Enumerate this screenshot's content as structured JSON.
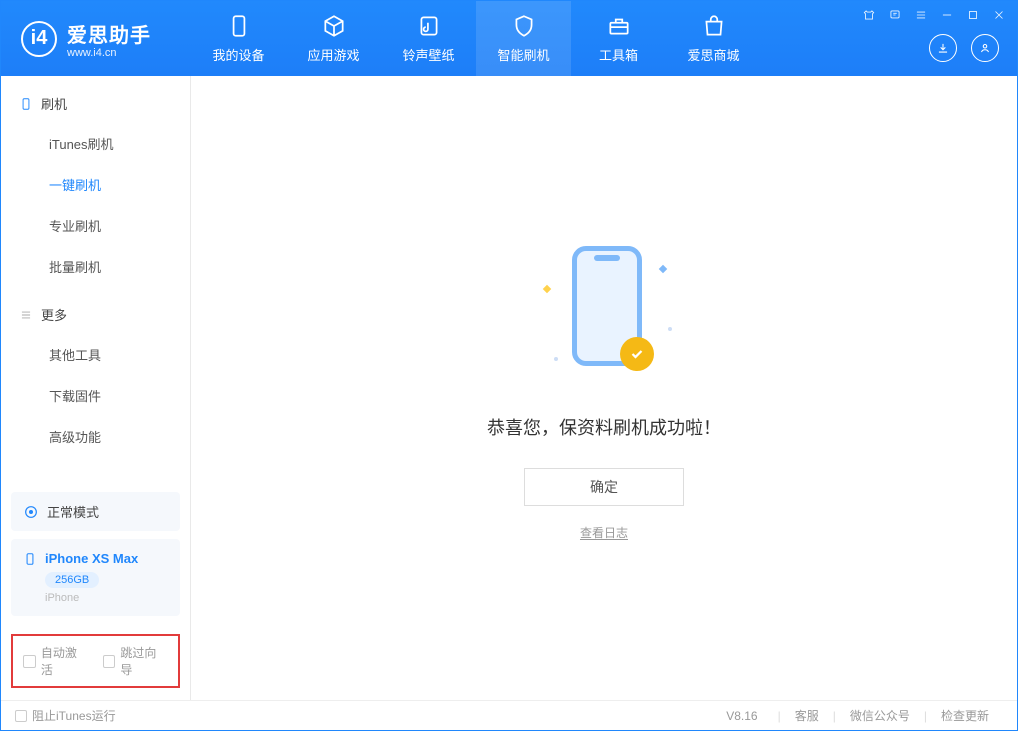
{
  "app": {
    "title": "爱思助手",
    "subtitle": "www.i4.cn"
  },
  "tabs": {
    "device": "我的设备",
    "apps": "应用游戏",
    "ring": "铃声壁纸",
    "flash": "智能刷机",
    "tools": "工具箱",
    "store": "爱思商城"
  },
  "sidebar": {
    "section_flash": "刷机",
    "itunes_flash": "iTunes刷机",
    "oneclick_flash": "一键刷机",
    "pro_flash": "专业刷机",
    "batch_flash": "批量刷机",
    "section_more": "更多",
    "other_tools": "其他工具",
    "download_fw": "下载固件",
    "advanced": "高级功能"
  },
  "device": {
    "mode": "正常模式",
    "name": "iPhone XS Max",
    "storage": "256GB",
    "type": "iPhone"
  },
  "checkboxes": {
    "auto_activate": "自动激活",
    "skip_guide": "跳过向导"
  },
  "main": {
    "success_msg": "恭喜您，保资料刷机成功啦！",
    "confirm": "确定",
    "view_log": "查看日志"
  },
  "footer": {
    "block_itunes": "阻止iTunes运行",
    "version": "V8.16",
    "support": "客服",
    "wechat": "微信公众号",
    "update": "检查更新"
  }
}
